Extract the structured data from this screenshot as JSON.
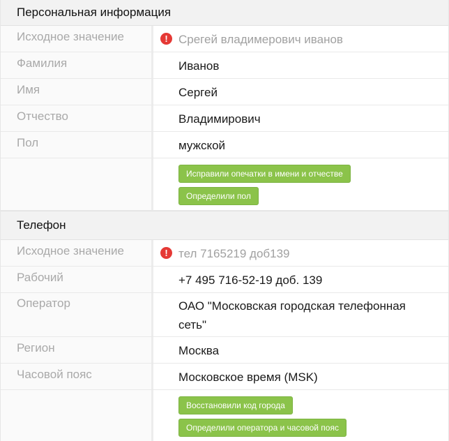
{
  "personal": {
    "title": "Персональная информация",
    "source": {
      "label": "Исходное значение",
      "value": "Срегей владимерович иванов",
      "icon": "alert-circle-icon"
    },
    "fields": [
      {
        "label": "Фамилия",
        "value": "Иванов"
      },
      {
        "label": "Имя",
        "value": "Сергей"
      },
      {
        "label": "Отчество",
        "value": "Владимирович"
      },
      {
        "label": "Пол",
        "value": "мужской"
      }
    ],
    "badges": [
      "Исправили опечатки в имени и отчестве",
      "Определили пол"
    ]
  },
  "phone": {
    "title": "Телефон",
    "source": {
      "label": "Исходное значение",
      "value": "тел 7165219 доб139",
      "icon": "alert-circle-icon"
    },
    "fields": [
      {
        "label": "Рабочий",
        "value": "+7 495 716-52-19 доб. 139"
      },
      {
        "label": "Оператор",
        "value": "ОАО \"Московская городская телефонная сеть\""
      },
      {
        "label": "Регион",
        "value": "Москва"
      },
      {
        "label": "Часовой пояс",
        "value": "Московское время (MSK)"
      }
    ],
    "badges": [
      "Восстановили код города",
      "Определили оператора и часовой пояс"
    ]
  },
  "colors": {
    "badge": "#8bc34a",
    "warning": "#e53935",
    "label": "#a9a9a9",
    "header_bg": "#f2f2f2"
  }
}
